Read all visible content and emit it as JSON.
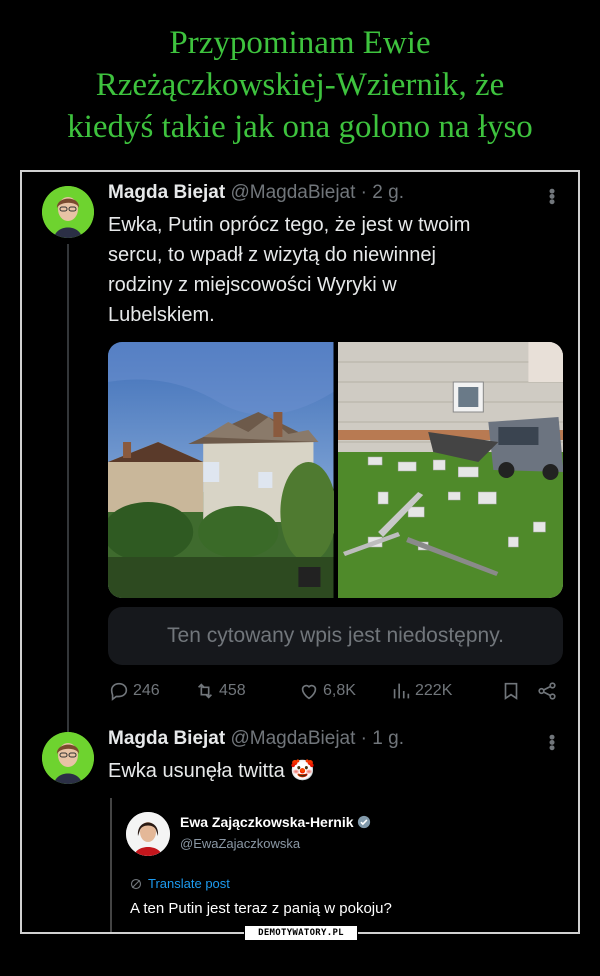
{
  "headline": {
    "line1": "Przypominam Ewie",
    "line2": "Rzeżączkowskiej-Wziernik, że",
    "line3": "kiedyś takie jak ona golono na łyso"
  },
  "tweet1": {
    "name": "Magda Biejat",
    "meta": "@MagdaBiejat · 2 g.",
    "text_lines": [
      "Ewka, Putin oprócz tego, że jest w twoim",
      "sercu, to wpadł z wizytą do niewinnej",
      "rodziny z miejscowości Wyryki w",
      "Lubelskiem."
    ],
    "quote_unavailable": "Ten cytowany wpis jest niedostępny.",
    "stats": {
      "replies": "246",
      "reposts": "458",
      "likes": "6,8K",
      "views": "222K"
    }
  },
  "tweet2": {
    "name": "Magda Biejat",
    "meta": "@MagdaBiejat · 1 g.",
    "text": "Ewka usunęła twitta",
    "emoji": "🤡"
  },
  "embedded": {
    "name": "Ewa Zajączkowska-Hernik",
    "handle": "@EwaZajaczkowska",
    "translate": "Translate post",
    "text": "A ten Putin jest teraz z panią w pokoju?"
  },
  "watermark": "DEMOTYWATORY.PL",
  "colors": {
    "headline": "#3ec33e",
    "avatar_bg": "#6ed32f",
    "link": "#1d9bf0",
    "muted": "#71767b"
  }
}
